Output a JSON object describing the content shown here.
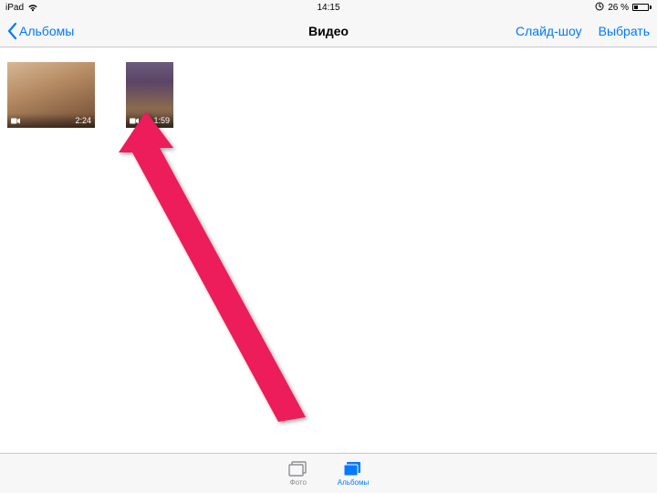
{
  "status": {
    "device": "iPad",
    "time": "14:15",
    "battery_pct": "26 %",
    "battery_fill_pct": 26
  },
  "nav": {
    "back_label": "Альбомы",
    "title": "Видео",
    "slideshow": "Слайд-шоу",
    "select": "Выбрать"
  },
  "videos": [
    {
      "duration": "2:24",
      "orientation": "landscape"
    },
    {
      "duration": "1:59",
      "orientation": "portrait"
    }
  ],
  "tabs": {
    "photos": "Фото",
    "albums": "Альбомы"
  }
}
